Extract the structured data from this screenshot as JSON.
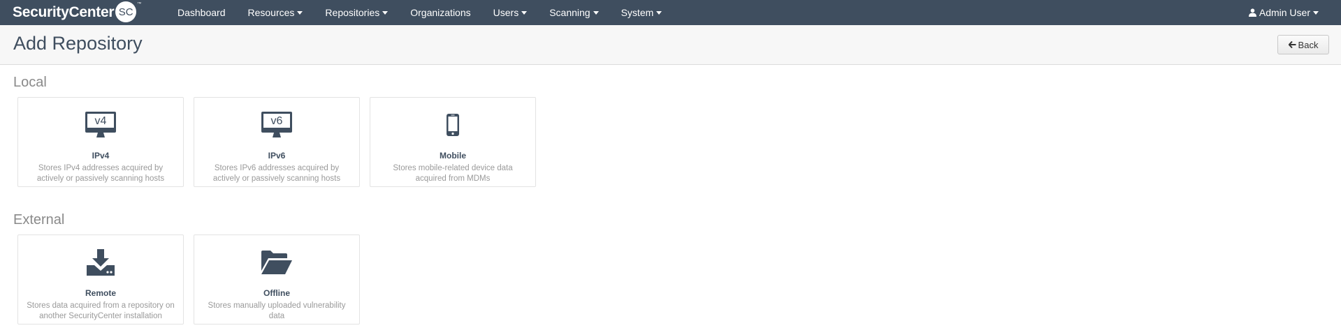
{
  "brand": {
    "name": "SecurityCenter",
    "badge": "SC",
    "tm": "™"
  },
  "nav": {
    "items": [
      {
        "label": "Dashboard",
        "dropdown": false
      },
      {
        "label": "Resources",
        "dropdown": true
      },
      {
        "label": "Repositories",
        "dropdown": true
      },
      {
        "label": "Organizations",
        "dropdown": false
      },
      {
        "label": "Users",
        "dropdown": true
      },
      {
        "label": "Scanning",
        "dropdown": true
      },
      {
        "label": "System",
        "dropdown": true
      }
    ],
    "user": {
      "label": "Admin User",
      "icon": "user-icon"
    }
  },
  "page": {
    "title": "Add Repository",
    "back_label": "Back"
  },
  "sections": {
    "local": {
      "title": "Local",
      "cards": [
        {
          "icon": "monitor-v4-icon",
          "icon_text": "v4",
          "title": "IPv4",
          "desc": "Stores IPv4 addresses acquired by actively or passively scanning hosts"
        },
        {
          "icon": "monitor-v6-icon",
          "icon_text": "v6",
          "title": "IPv6",
          "desc": "Stores IPv6 addresses acquired by actively or passively scanning hosts"
        },
        {
          "icon": "mobile-phone-icon",
          "title": "Mobile",
          "desc": "Stores mobile-related device data acquired from MDMs"
        }
      ]
    },
    "external": {
      "title": "External",
      "cards": [
        {
          "icon": "download-icon",
          "title": "Remote",
          "desc": "Stores data acquired from a repository on another SecurityCenter installation"
        },
        {
          "icon": "folder-open-icon",
          "title": "Offline",
          "desc": "Stores manually uploaded vulnerability data"
        }
      ]
    }
  },
  "colors": {
    "navbar": "#3f4e5f",
    "header_bg": "#f7f7f7",
    "icon": "#3f4e5f",
    "muted_text": "#9a9a9a"
  }
}
